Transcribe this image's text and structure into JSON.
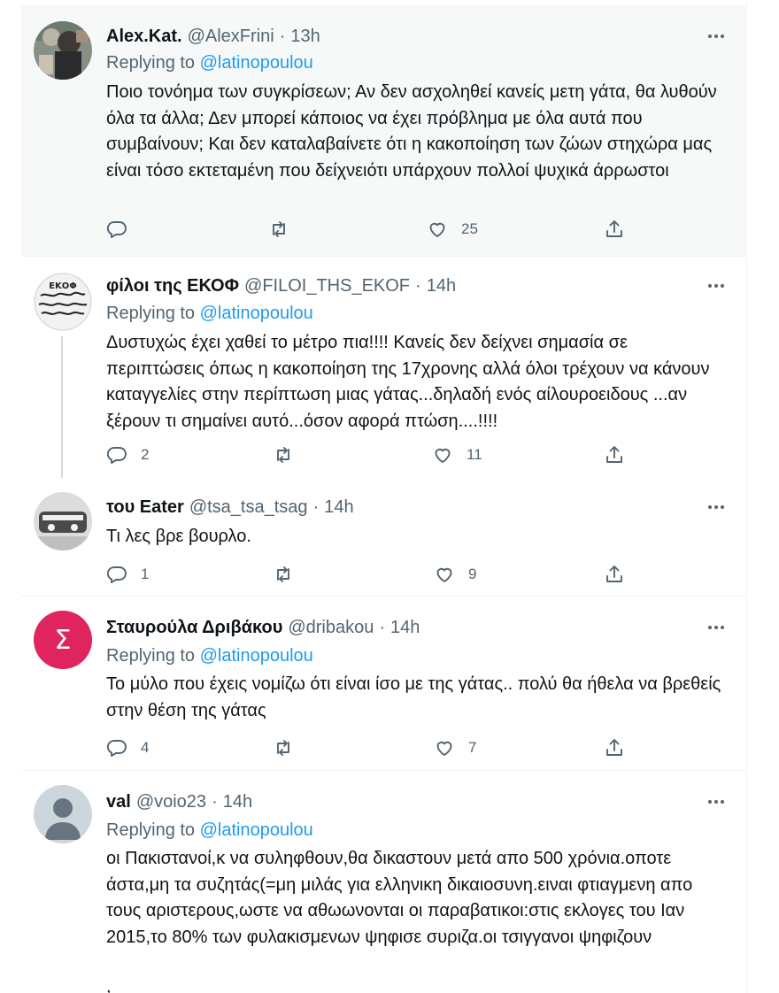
{
  "tweets": [
    {
      "name": "Alex.Kat.",
      "handle": "@AlexFrini",
      "time": "13h",
      "replying_prefix": "Replying to",
      "replying_to": "@latinopoulou",
      "text": "Ποιο τονόημα των συγκρίσεων; Αν δεν ασχοληθεί κανείς μετη γάτα, θα λυθούν όλα τα άλλα; Δεν μπορεί κάποιος να έχει πρόβλημα με όλα αυτά που συμβαίνουν; Και δεν καταλαβαίνετε ότι η κακοποίηση των ζώων στηχώρα μας είναι τόσο εκτεταμένη που δείχνειότι υπάρχουν πολλοί ψυχικά άρρωστοι",
      "replies": "",
      "retweets": "",
      "likes": "25",
      "highlighted": true
    },
    {
      "name": "φίλοι της ΕΚΟΦ",
      "handle": "@FILOI_THS_EKOF",
      "time": "14h",
      "replying_prefix": "Replying to",
      "replying_to": "@latinopoulou",
      "text": "Δυστυχώς έχει χαθεί το μέτρο πια!!!! Κανείς δεν δείχνει σημασία σε περιπτώσεις όπως η κακοποίηση της 17χρονης αλλά όλοι τρέχουν να κάνουν καταγγελίες στην περίπτωση μιας γάτας...δηλαδή ενός αίλουροειδους ...αν ξέρουν τι σημαίνει αυτό...όσον αφορά πτώση....!!!!",
      "replies": "2",
      "retweets": "",
      "likes": "11",
      "avatar_text": "ΕΚΟΦ"
    },
    {
      "name": "του Eater",
      "handle": "@tsa_tsa_tsag",
      "time": "14h",
      "text": "Τι λες βρε βουρλο.",
      "replies": "1",
      "retweets": "",
      "likes": "9"
    },
    {
      "name": "Σταυρούλα Δριβάκου",
      "handle": "@dribakou",
      "time": "14h",
      "replying_prefix": "Replying to",
      "replying_to": "@latinopoulou",
      "text": "Το μύλο που έχεις νομίζω ότι είναι ίσο με της γάτας.. πολύ θα ήθελα να βρεθείς στην θέση της γάτας",
      "replies": "4",
      "retweets": "",
      "likes": "7",
      "avatar_letter": "Σ",
      "avatar_color": "#e0245e"
    },
    {
      "name": "val",
      "handle": "@voio23",
      "time": "14h",
      "replying_prefix": "Replying to",
      "replying_to": "@latinopoulou",
      "text": "οι Πακιστανοί,κ να συληφθουν,θα δικαστουν μετά απο 500 χρόνια.οποτε άστα,μη τα συζητάς(=μη μιλάς για ελληνικη δικαιοσυνη.ειναι φτιαγμενη απο τους αριστερους,ωστε να αθωωνονται οι παραβατικοι:στις εκλογες του Ιαν 2015,το 80% των φυλακισμενων ψηφισε συριζα.οι τσιγγανοι ψηφιζουν",
      "text_extra": ",",
      "avatar_color": "#ccd6dd"
    }
  ],
  "colors": {
    "link": "#1d9bf0",
    "secondary": "#536471",
    "highlight_bg": "#f7f9f9",
    "divider": "#eff3f4"
  },
  "icons": [
    "reply-icon",
    "retweet-icon",
    "like-icon",
    "share-icon",
    "more-icon"
  ]
}
